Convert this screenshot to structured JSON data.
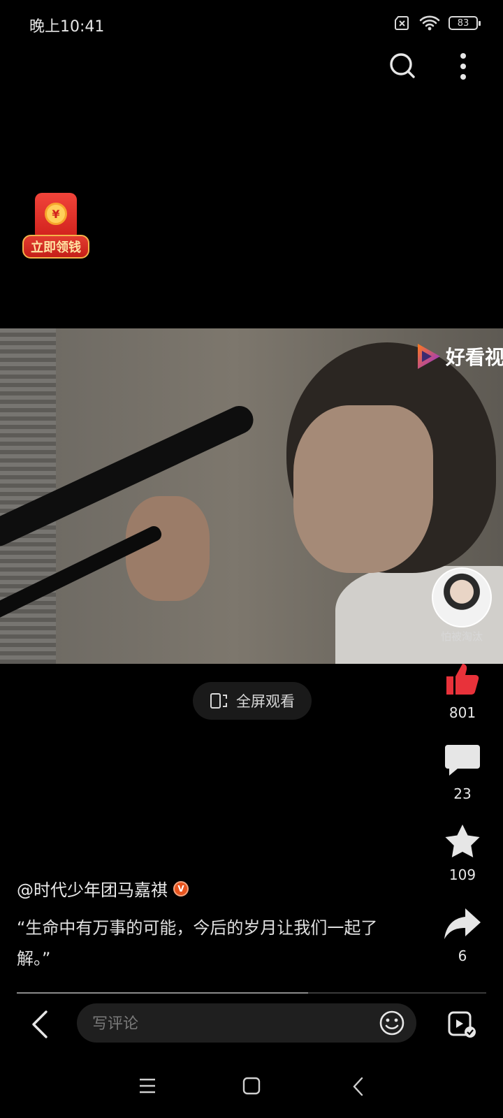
{
  "status_bar": {
    "time": "晚上10:41",
    "battery": "83",
    "icons": [
      "sim-off-icon",
      "wifi-icon",
      "battery-icon"
    ]
  },
  "top_bar": {
    "icons": [
      "search-icon",
      "more-vertical-icon"
    ]
  },
  "red_packet": {
    "coin": "¥",
    "label": "立即领钱"
  },
  "video": {
    "watermark": "好看视"
  },
  "creator": {
    "name": "怕被淘汰"
  },
  "fullscreen_button": {
    "label": "全屏观看"
  },
  "actions": {
    "like_count": "801",
    "comment_count": "23",
    "favorite_count": "109",
    "share_count": "6"
  },
  "post": {
    "author": "@时代少年团马嘉祺",
    "badge": "V",
    "description": "“生命中有万事的可能，今后的岁月让我们一起了解。”"
  },
  "progress": {
    "fraction": 0.62
  },
  "bottom_bar": {
    "comment_placeholder": "写评论"
  },
  "colors": {
    "like": "#e8323a",
    "background": "#000000",
    "badge": "#e8541e"
  }
}
